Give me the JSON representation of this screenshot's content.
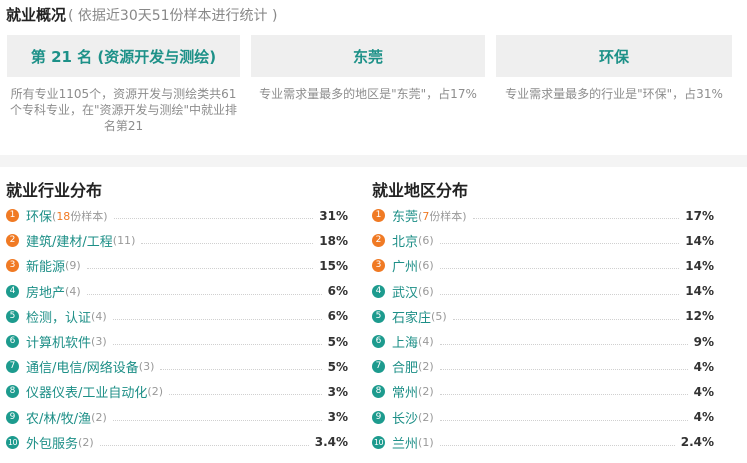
{
  "header": {
    "title": "就业概况",
    "subtitle": "( 依据近30天51份样本进行统计 )"
  },
  "cards": [
    {
      "title": "第 21 名 (资源开发与测绘)",
      "desc": "所有专业1105个，资源开发与测绘类共61个专科专业，在\"资源开发与测绘\"中就业排名第21"
    },
    {
      "title": "东莞",
      "desc": "专业需求量最多的地区是\"东莞\"，占17%"
    },
    {
      "title": "环保",
      "desc": "专业需求量最多的行业是\"环保\"，占31%"
    }
  ],
  "industry": {
    "title": "就业行业分布",
    "items": [
      {
        "rank": "1",
        "name": "环保",
        "count_open": "(",
        "count_num": "18",
        "count_close": "份样本)",
        "percent": "31%"
      },
      {
        "rank": "2",
        "name": "建筑/建材/工程",
        "count_open": "(",
        "count_num": "11",
        "count_close": ")",
        "percent": "18%"
      },
      {
        "rank": "3",
        "name": "新能源",
        "count_open": "(",
        "count_num": "9",
        "count_close": ")",
        "percent": "15%"
      },
      {
        "rank": "4",
        "name": "房地产",
        "count_open": "(",
        "count_num": "4",
        "count_close": ")",
        "percent": "6%"
      },
      {
        "rank": "5",
        "name": "检测，认证",
        "count_open": "(",
        "count_num": "4",
        "count_close": ")",
        "percent": "6%"
      },
      {
        "rank": "6",
        "name": "计算机软件",
        "count_open": "(",
        "count_num": "3",
        "count_close": ")",
        "percent": "5%"
      },
      {
        "rank": "7",
        "name": "通信/电信/网络设备",
        "count_open": "(",
        "count_num": "3",
        "count_close": ")",
        "percent": "5%"
      },
      {
        "rank": "8",
        "name": "仪器仪表/工业自动化",
        "count_open": "(",
        "count_num": "2",
        "count_close": ")",
        "percent": "3%"
      },
      {
        "rank": "9",
        "name": "农/林/牧/渔",
        "count_open": "(",
        "count_num": "2",
        "count_close": ")",
        "percent": "3%"
      },
      {
        "rank": "10",
        "name": "外包服务",
        "count_open": "(",
        "count_num": "2",
        "count_close": ")",
        "percent": "3.4%"
      }
    ]
  },
  "region": {
    "title": "就业地区分布",
    "items": [
      {
        "rank": "1",
        "name": "东莞",
        "count_open": "(",
        "count_num": "7",
        "count_close": "份样本)",
        "percent": "17%"
      },
      {
        "rank": "2",
        "name": "北京",
        "count_open": "(",
        "count_num": "6",
        "count_close": ")",
        "percent": "14%"
      },
      {
        "rank": "3",
        "name": "广州",
        "count_open": "(",
        "count_num": "6",
        "count_close": ")",
        "percent": "14%"
      },
      {
        "rank": "4",
        "name": "武汉",
        "count_open": "(",
        "count_num": "6",
        "count_close": ")",
        "percent": "14%"
      },
      {
        "rank": "5",
        "name": "石家庄",
        "count_open": "(",
        "count_num": "5",
        "count_close": ")",
        "percent": "12%"
      },
      {
        "rank": "6",
        "name": "上海",
        "count_open": "(",
        "count_num": "4",
        "count_close": ")",
        "percent": "9%"
      },
      {
        "rank": "7",
        "name": "合肥",
        "count_open": "(",
        "count_num": "2",
        "count_close": ")",
        "percent": "4%"
      },
      {
        "rank": "8",
        "name": "常州",
        "count_open": "(",
        "count_num": "2",
        "count_close": ")",
        "percent": "4%"
      },
      {
        "rank": "9",
        "name": "长沙",
        "count_open": "(",
        "count_num": "2",
        "count_close": ")",
        "percent": "4%"
      },
      {
        "rank": "10",
        "name": "兰州",
        "count_open": "(",
        "count_num": "1",
        "count_close": ")",
        "percent": "2.4%"
      }
    ]
  },
  "colors": {
    "accent": "#1d9188",
    "rank_top": "#f07a24",
    "rank_rest": "#1d9b8e",
    "card_bg": "#efefef",
    "divider_bg": "#f4f4f4"
  }
}
